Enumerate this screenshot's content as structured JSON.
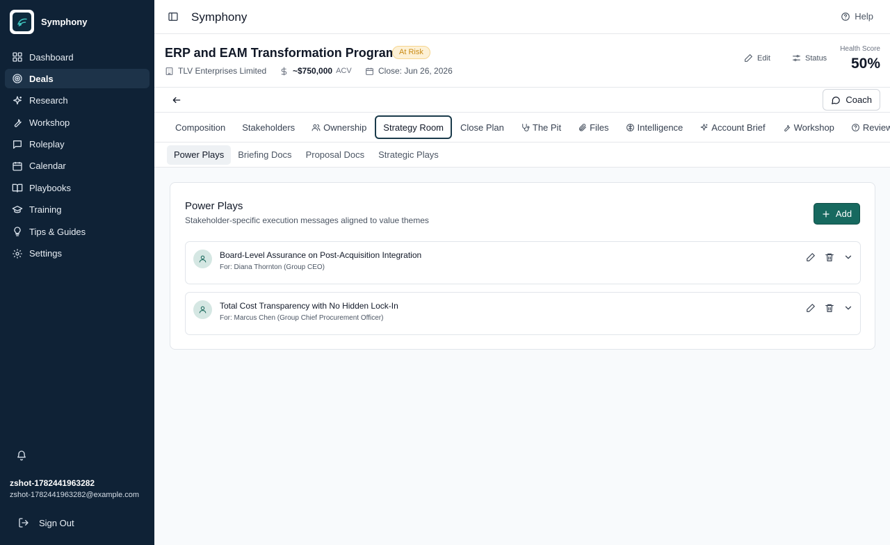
{
  "app": {
    "name": "Symphony"
  },
  "sidebar": {
    "items": [
      {
        "label": "Dashboard",
        "icon": "grid-icon"
      },
      {
        "label": "Deals",
        "icon": "target-icon",
        "active": true
      },
      {
        "label": "Research",
        "icon": "sparkles-icon"
      },
      {
        "label": "Workshop",
        "icon": "wrench-icon"
      },
      {
        "label": "Roleplay",
        "icon": "chat-icon"
      },
      {
        "label": "Calendar",
        "icon": "calendar-icon"
      },
      {
        "label": "Playbooks",
        "icon": "book-icon"
      },
      {
        "label": "Training",
        "icon": "graduation-cap-icon"
      },
      {
        "label": "Tips & Guides",
        "icon": "lightbulb-icon"
      },
      {
        "label": "Settings",
        "icon": "gear-icon"
      }
    ],
    "user": {
      "name": "zshot-1782441963282",
      "email": "zshot-1782441963282@example.com"
    },
    "sign_out": "Sign Out"
  },
  "topbar": {
    "title": "Symphony",
    "help": "Help"
  },
  "deal": {
    "title": "ERP and EAM Transformation Program",
    "status_badge": "At Risk",
    "company": "TLV Enterprises Limited",
    "value": "~$750,000",
    "value_unit": "ACV",
    "close": "Close: Jun 26, 2026",
    "edit": "Edit",
    "status": "Status",
    "health_label": "Health Score",
    "health_value": "50%"
  },
  "coach": "Coach",
  "tabs": [
    {
      "label": "Composition",
      "icon": ""
    },
    {
      "label": "Stakeholders",
      "icon": ""
    },
    {
      "label": "Ownership",
      "icon": "users-icon"
    },
    {
      "label": "Strategy Room",
      "icon": "",
      "active": true
    },
    {
      "label": "Close Plan",
      "icon": ""
    },
    {
      "label": "The Pit",
      "icon": "stethoscope-icon"
    },
    {
      "label": "Files",
      "icon": "paperclip-icon"
    },
    {
      "label": "Intelligence",
      "icon": "brain-icon"
    },
    {
      "label": "Account Brief",
      "icon": "sparkles-icon"
    },
    {
      "label": "Workshop",
      "icon": "wrench-icon"
    },
    {
      "label": "Review Items",
      "icon": "question-circle-icon"
    }
  ],
  "subtabs": [
    {
      "label": "Power Plays",
      "active": true
    },
    {
      "label": "Briefing Docs"
    },
    {
      "label": "Proposal Docs"
    },
    {
      "label": "Strategic Plays"
    }
  ],
  "power_plays": {
    "title": "Power Plays",
    "subtitle": "Stakeholder-specific execution messages aligned to value themes",
    "add_label": "Add",
    "items": [
      {
        "title": "Board-Level Assurance on Post-Acquisition Integration",
        "for": "For: Diana Thornton (Group CEO)"
      },
      {
        "title": "Total Cost Transparency with No Hidden Lock-In",
        "for": "For: Marcus Chen (Group Chief Procurement Officer)"
      }
    ]
  },
  "colors": {
    "sidebar": "#0f2236",
    "accent": "#17695f",
    "risk": "#c98a14"
  }
}
